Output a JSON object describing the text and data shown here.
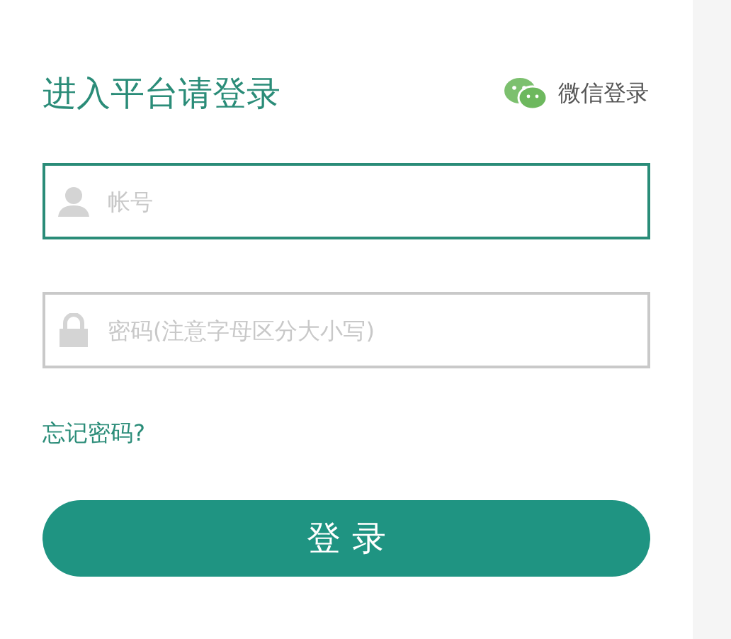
{
  "title": "进入平台请登录",
  "wechat_login": "微信登录",
  "fields": [
    {
      "kind": "user",
      "placeholder": "帐号",
      "focused": true
    },
    {
      "kind": "lock",
      "placeholder": "密码(注意字母区分大小写)",
      "focused": false
    }
  ],
  "forgot_link": "忘记密码?",
  "submit_button": "登 录"
}
